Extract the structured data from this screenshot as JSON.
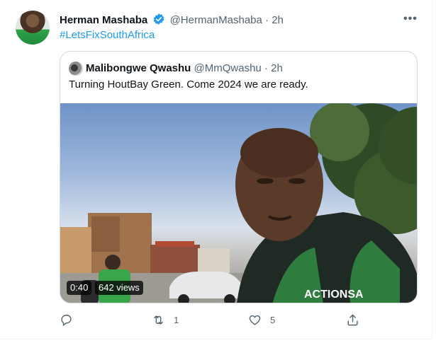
{
  "tweet": {
    "author_name": "Herman Mashaba",
    "author_handle": "@HermanMashaba",
    "separator": "·",
    "time": "2h",
    "more_icon": "more-horizontal-icon",
    "text": "#LetsFixSouthAfrica"
  },
  "quoted_tweet": {
    "author_name": "Malibongwe Qwashu",
    "author_handle": "@MmQwashu",
    "separator": "·",
    "time": "2h",
    "text": "Turning HoutBay Green. Come 2024 we are ready.",
    "video": {
      "duration": "0:40",
      "views": "642 views",
      "shirt_text": "ACTIONSA"
    }
  },
  "actions": {
    "reply_count": "",
    "retweet_count": "1",
    "like_count": "5",
    "share_count": ""
  },
  "colors": {
    "accent": "#1d9bf0",
    "muted": "#536471",
    "border": "#cfd9de"
  }
}
